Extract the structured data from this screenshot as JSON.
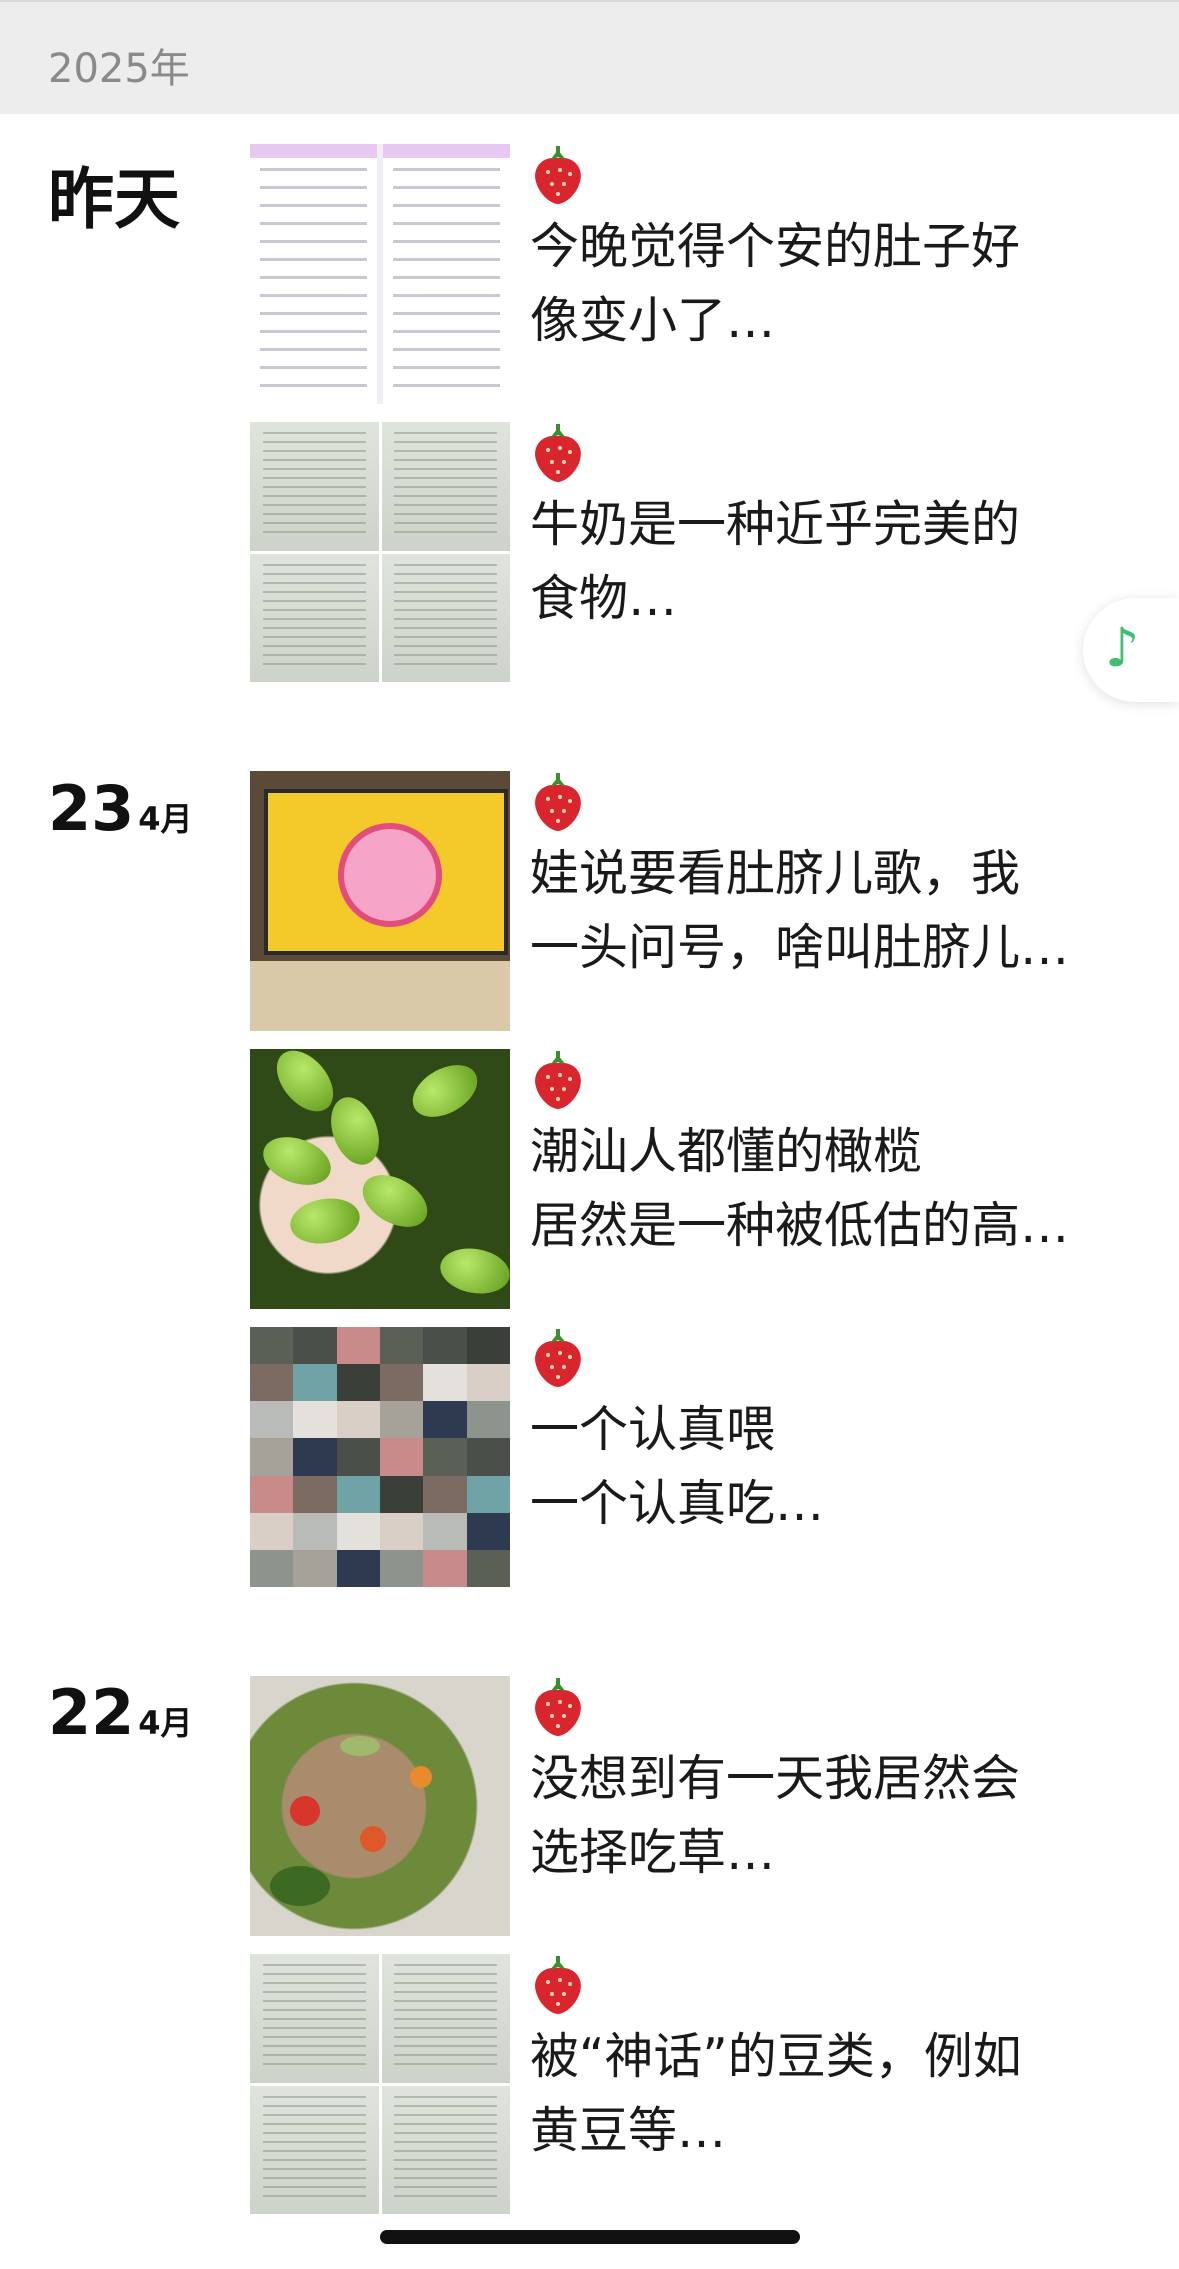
{
  "year_header": "2025年",
  "groups": [
    {
      "label": "昨天",
      "day": "",
      "month": "",
      "posts": [
        {
          "text": "今晚觉得个安的肚子好\n像变小了…",
          "thumb": "app-screenshots"
        },
        {
          "text": "牛奶是一种近乎完美的\n食物…",
          "thumb": "book-pages"
        }
      ]
    },
    {
      "label": "",
      "day": "23",
      "month": "4月",
      "posts": [
        {
          "text": "娃说要看肚脐儿歌，我\n一头问号，啥叫肚脐儿…",
          "thumb": "tv-cartoon"
        },
        {
          "text": "潮汕人都懂的橄榄\n居然是一种被低估的高…",
          "thumb": "olives"
        },
        {
          "text": "一个认真喂\n一个认真吃…",
          "thumb": "mosaic"
        }
      ]
    },
    {
      "label": "",
      "day": "22",
      "month": "4月",
      "posts": [
        {
          "text": "没想到有一天我居然会\n选择吃草…",
          "thumb": "salad"
        },
        {
          "text": "被“神话”的豆类，例如\n黄豆等…",
          "thumb": "book-pages"
        }
      ]
    }
  ],
  "post_icon": "strawberry-icon",
  "floating_button_icon": "music-note-icon",
  "colors": {
    "accent": "#3fbf72",
    "header_bg": "#ededed",
    "strawberry": "#d9252d"
  }
}
